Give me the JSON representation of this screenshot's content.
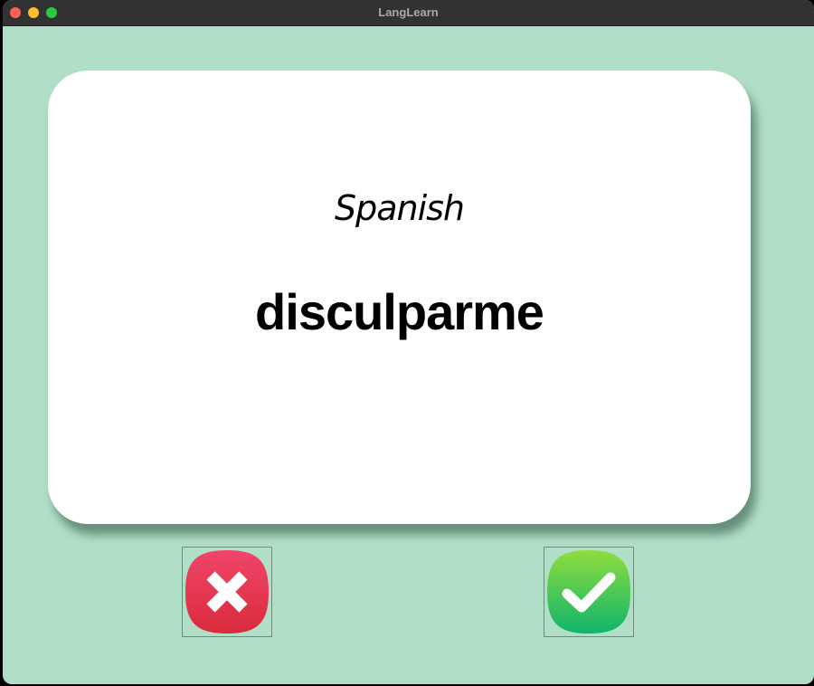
{
  "window": {
    "title": "LangLearn"
  },
  "card": {
    "language": "Spanish",
    "word": "disculparme"
  },
  "buttons": {
    "wrong_icon": "cross-icon",
    "correct_icon": "checkmark-icon"
  },
  "colors": {
    "background": "#b1dec7",
    "card": "#ffffff",
    "wrong": "#e8304f",
    "correct": "#2dc65a"
  }
}
